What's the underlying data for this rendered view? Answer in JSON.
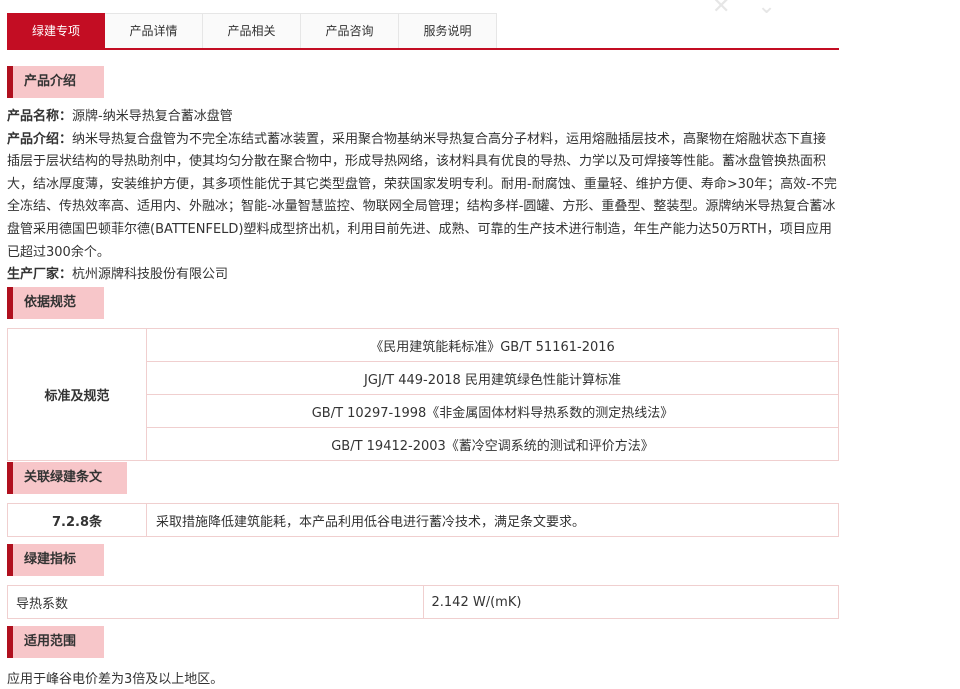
{
  "tabs": [
    "绿建专项",
    "产品详情",
    "产品相关",
    "产品咨询",
    "服务说明"
  ],
  "sections": {
    "intro": "产品介绍",
    "standards": "依据规范",
    "clauses": "关联绿建条文",
    "indicators": "绿建指标",
    "scope": "适用范围"
  },
  "product": {
    "name_label": "产品名称：",
    "name": "源牌-纳米导热复合蓄冰盘管",
    "intro_label": "产品介绍：",
    "intro": "纳米导热复合盘管为不完全冻结式蓄冰装置，采用聚合物基纳米导热复合高分子材料，运用熔融插层技术，高聚物在熔融状态下直接插层于层状结构的导热助剂中，使其均匀分散在聚合物中，形成导热网络，该材料具有优良的导热、力学以及可焊接等性能。蓄冰盘管换热面积大，结冰厚度薄，安装维护方便，其多项性能优于其它类型盘管，荣获国家发明专利。耐用-耐腐蚀、重量轻、维护方便、寿命>30年；高效-不完全冻结、传热效率高、适用内、外融冰；智能-冰量智慧监控、物联网全局管理；结构多样-圆罐、方形、重叠型、整装型。源牌纳米导热复合蓄冰盘管采用德国巴顿菲尔德(BATTENFELD)塑料成型挤出机，利用目前先进、成熟、可靠的生产技术进行制造，年生产能力达50万RTH，项目应用已超过300余个。",
    "maker_label": "生产厂家：",
    "maker": "杭州源牌科技股份有限公司"
  },
  "standards": {
    "header": "标准及规范",
    "items": [
      "《民用建筑能耗标准》GB/T 51161-2016",
      "JGJ/T 449-2018 民用建筑绿色性能计算标准",
      "GB/T 10297-1998《非金属固体材料导热系数的测定热线法》",
      "GB/T 19412-2003《蓄冷空调系统的测试和评价方法》"
    ]
  },
  "clause": {
    "id": "7.2.8条",
    "text": "采取措施降低建筑能耗，本产品利用低谷电进行蓄冷技术，满足条文要求。"
  },
  "indicator": {
    "name": "导热系数",
    "value": "2.142 W/(mK)"
  },
  "scope_text": "应用于峰谷电价差为3倍及以上地区。"
}
